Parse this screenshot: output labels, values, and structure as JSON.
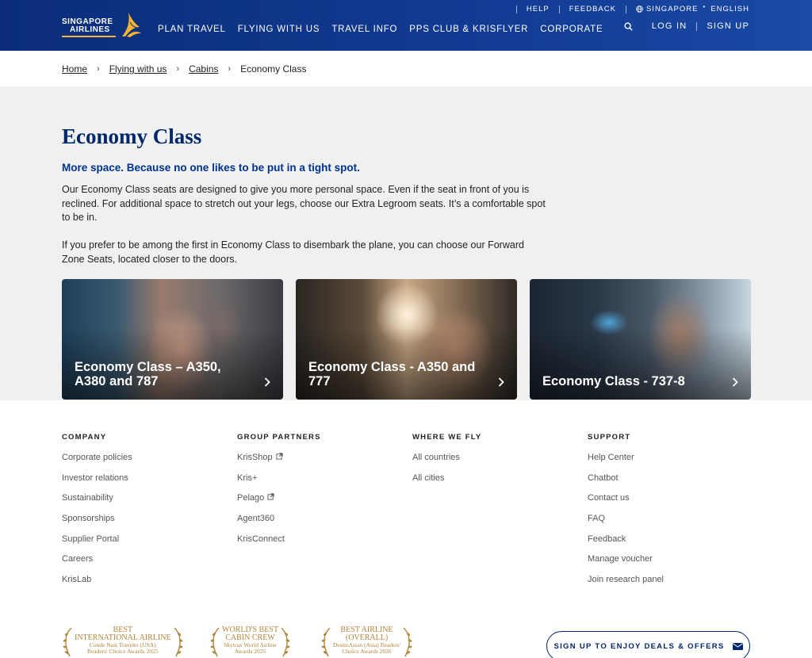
{
  "brand": {
    "line1": "SINGAPORE",
    "line2": "AIRLINES",
    "underline_color": "#f5b233",
    "header_color": "#0b2d7a"
  },
  "main_nav": [
    "PLAN TRAVEL",
    "FLYING WITH US",
    "TRAVEL INFO",
    "PPS CLUB & KRISFLYER",
    "CORPORATE"
  ],
  "utility_nav": {
    "help": "HELP",
    "feedback": "FEEDBACK",
    "country": "SINGAPORE",
    "language": "ENGLISH",
    "globe_icon": "globe-icon"
  },
  "account": {
    "login": "LOG IN",
    "signup": "SIGN UP",
    "search_icon": "search-icon"
  },
  "breadcrumb": [
    {
      "label": "Home"
    },
    {
      "label": "Flying with us"
    },
    {
      "label": "Cabins"
    },
    {
      "label": "Economy Class"
    }
  ],
  "page": {
    "title": "Economy Class",
    "subtitle": "More space. Because no one likes to be put in a tight spot.",
    "para1": "Our Economy Class seats are designed to give you more personal space. Even if the seat in front of you is reclined. For additional space to stretch out your legs, choose our Extra Legroom seats. It’s a comfortable spot to be in.",
    "para2": "If you prefer to be among the first in Economy Class to disembark the plane, you can choose our Forward Zone Seats, located closer to the doors."
  },
  "cards": [
    {
      "label": "Economy Class – A350, A380 and 787"
    },
    {
      "label": "Economy Class - A350 and 777"
    },
    {
      "label": "Economy Class - 737-8"
    }
  ],
  "footer": {
    "company": {
      "title": "COMPANY",
      "links": [
        "Corporate policies",
        "Investor relations",
        "Sustainability",
        "Sponsorships",
        "Supplier Portal",
        "Careers",
        "KrisLab"
      ]
    },
    "partners": {
      "title": "GROUP PARTNERS",
      "links": [
        {
          "label": "KrisShop",
          "external": true
        },
        {
          "label": "Kris+",
          "external": false
        },
        {
          "label": "Pelago",
          "external": true
        },
        {
          "label": "Agent360",
          "external": false
        },
        {
          "label": "KrisConnect",
          "external": false
        }
      ]
    },
    "where": {
      "title": "WHERE WE FLY",
      "links": [
        "All countries",
        "All cities"
      ]
    },
    "support": {
      "title": "SUPPORT",
      "links": [
        "Help Center",
        "Chatbot",
        "Contact us",
        "FAQ",
        "Feedback",
        "Manage voucher",
        "Join research panel"
      ]
    }
  },
  "awards": [
    {
      "line1": "BEST",
      "line2": "INTERNATIONAL AIRLINE",
      "line3": "Conde Nast Traveler (USA)",
      "line4": "Readers' Choice Awards 2025"
    },
    {
      "line1": "WORLD'S BEST",
      "line2": "CABIN CREW",
      "line3": "Skytrax World Airline",
      "line4": "Awards 2025"
    },
    {
      "line1": "BEST AIRLINE",
      "line2": "(OVERALL)",
      "line3": "DestinAsian (Asia) Readers'",
      "line4": "Choice Awards 2026"
    }
  ],
  "newsletter": {
    "label": "SIGN UP TO ENJOY DEALS & OFFERS",
    "icon": "mail-icon"
  }
}
